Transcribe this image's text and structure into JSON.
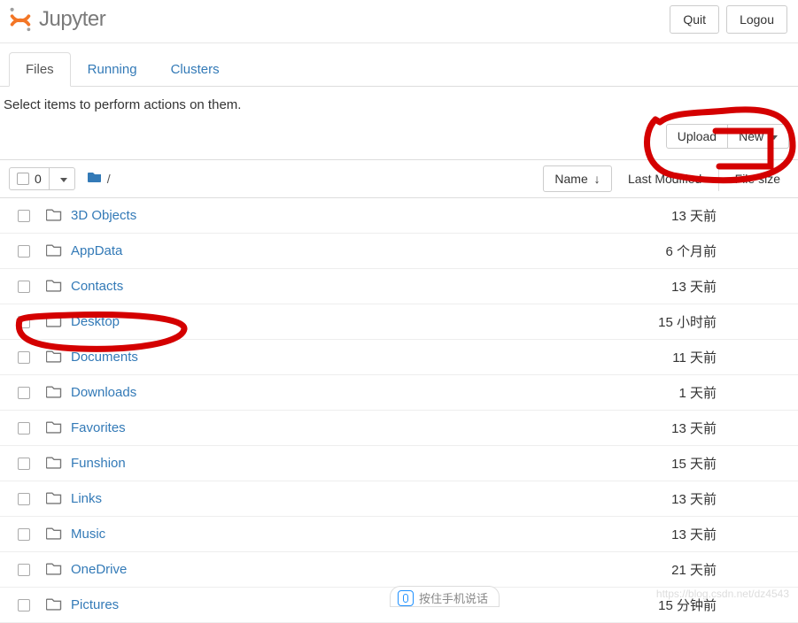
{
  "header": {
    "logo_text": "Jupyter",
    "quit_label": "Quit",
    "logout_label": "Logou"
  },
  "tabs": {
    "files": "Files",
    "running": "Running",
    "clusters": "Clusters"
  },
  "hint_text": "Select items to perform actions on them.",
  "actions": {
    "upload_label": "Upload",
    "new_label": "New"
  },
  "list_header": {
    "selected_count": "0",
    "breadcrumb_sep": "/",
    "name_col": "Name",
    "lastmod_col": "Last Modified",
    "filesize_col": "File size"
  },
  "files": [
    {
      "name": "3D Objects",
      "modified": "13 天前"
    },
    {
      "name": "AppData",
      "modified": "6 个月前"
    },
    {
      "name": "Contacts",
      "modified": "13 天前"
    },
    {
      "name": "Desktop",
      "modified": "15 小时前"
    },
    {
      "name": "Documents",
      "modified": "11 天前"
    },
    {
      "name": "Downloads",
      "modified": "1 天前"
    },
    {
      "name": "Favorites",
      "modified": "13 天前"
    },
    {
      "name": "Funshion",
      "modified": "15 天前"
    },
    {
      "name": "Links",
      "modified": "13 天前"
    },
    {
      "name": "Music",
      "modified": "13 天前"
    },
    {
      "name": "OneDrive",
      "modified": "21 天前"
    },
    {
      "name": "Pictures",
      "modified": "15 分钟前"
    }
  ],
  "widget_text": "按住手机说话",
  "watermark_text": "https://blog.csdn.net/dz4543"
}
